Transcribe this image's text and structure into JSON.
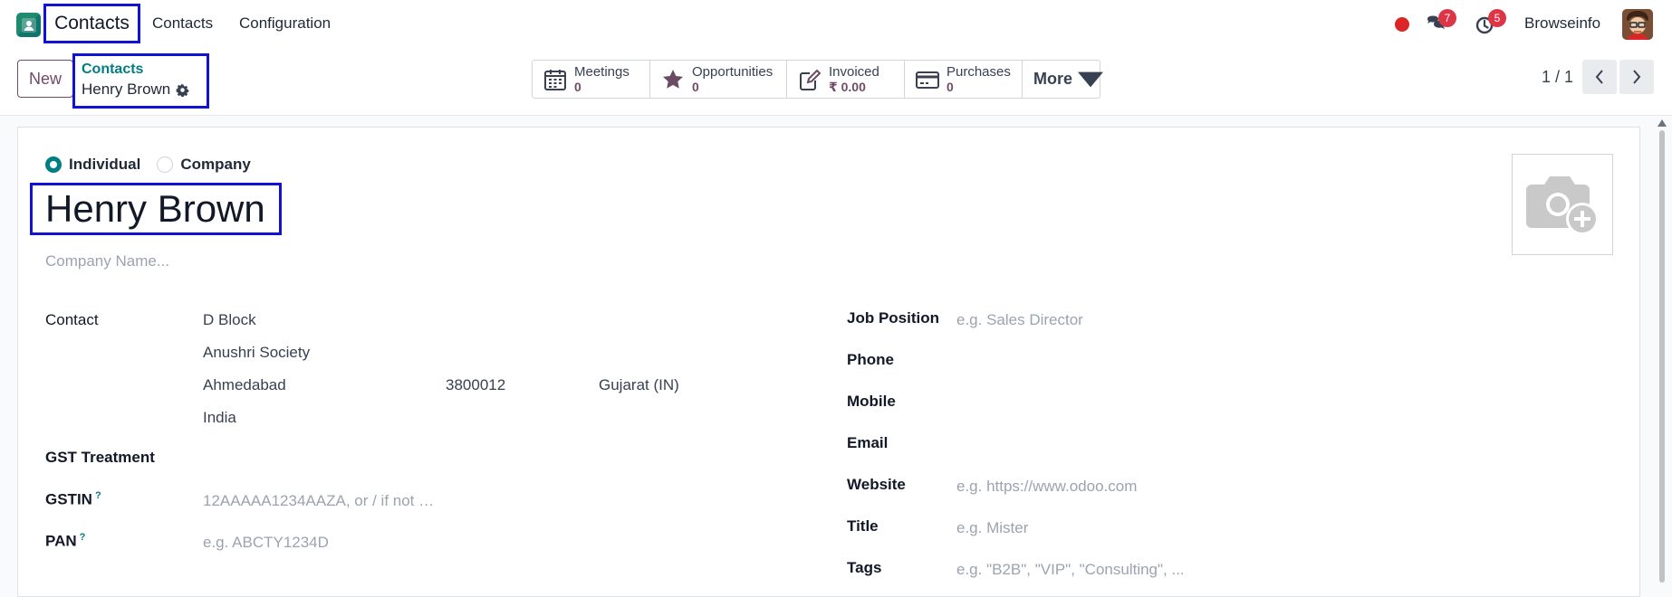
{
  "topbar": {
    "app_name": "Contacts",
    "menu": [
      "Contacts",
      "Configuration"
    ],
    "messages_count": "7",
    "activities_count": "5",
    "user_name": "Browseinfo"
  },
  "control": {
    "new_label": "New",
    "breadcrumb_parent": "Contacts",
    "breadcrumb_current": "Henry Brown",
    "smart_buttons": [
      {
        "label": "Meetings",
        "value": "0",
        "icon": "calendar-icon"
      },
      {
        "label": "Opportunities",
        "value": "0",
        "icon": "star-icon"
      },
      {
        "label": "Invoiced",
        "value": "₹ 0.00",
        "icon": "edit-invoice-icon"
      },
      {
        "label": "Purchases",
        "value": "0",
        "icon": "credit-card-icon"
      }
    ],
    "more_label": "More",
    "pager": "1 / 1"
  },
  "form": {
    "type_individual": "Individual",
    "type_company": "Company",
    "name": "Henry Brown",
    "company_placeholder": "Company Name...",
    "left": {
      "contact_label": "Contact",
      "street": "D Block",
      "street2": "Anushri Society",
      "city": "Ahmedabad",
      "zip": "3800012",
      "state": "Gujarat (IN)",
      "country": "India",
      "gst_treatment_label": "GST Treatment",
      "gstin_label": "GSTIN",
      "gstin_placeholder": "12AAAAA1234AAZA, or / if not …",
      "pan_label": "PAN",
      "pan_placeholder": "e.g. ABCTY1234D",
      "help_mark": "?"
    },
    "right": {
      "job_label": "Job Position",
      "job_placeholder": "e.g. Sales Director",
      "phone_label": "Phone",
      "mobile_label": "Mobile",
      "email_label": "Email",
      "website_label": "Website",
      "website_placeholder": "e.g. https://www.odoo.com",
      "title_label": "Title",
      "title_placeholder": "e.g. Mister",
      "tags_label": "Tags",
      "tags_placeholder": "e.g. \"B2B\", \"VIP\", \"Consulting\", ..."
    }
  },
  "colors": {
    "brand": "#714b67",
    "accent": "#017e84",
    "highlight": "#1212d4",
    "badge": "#dc3545"
  }
}
